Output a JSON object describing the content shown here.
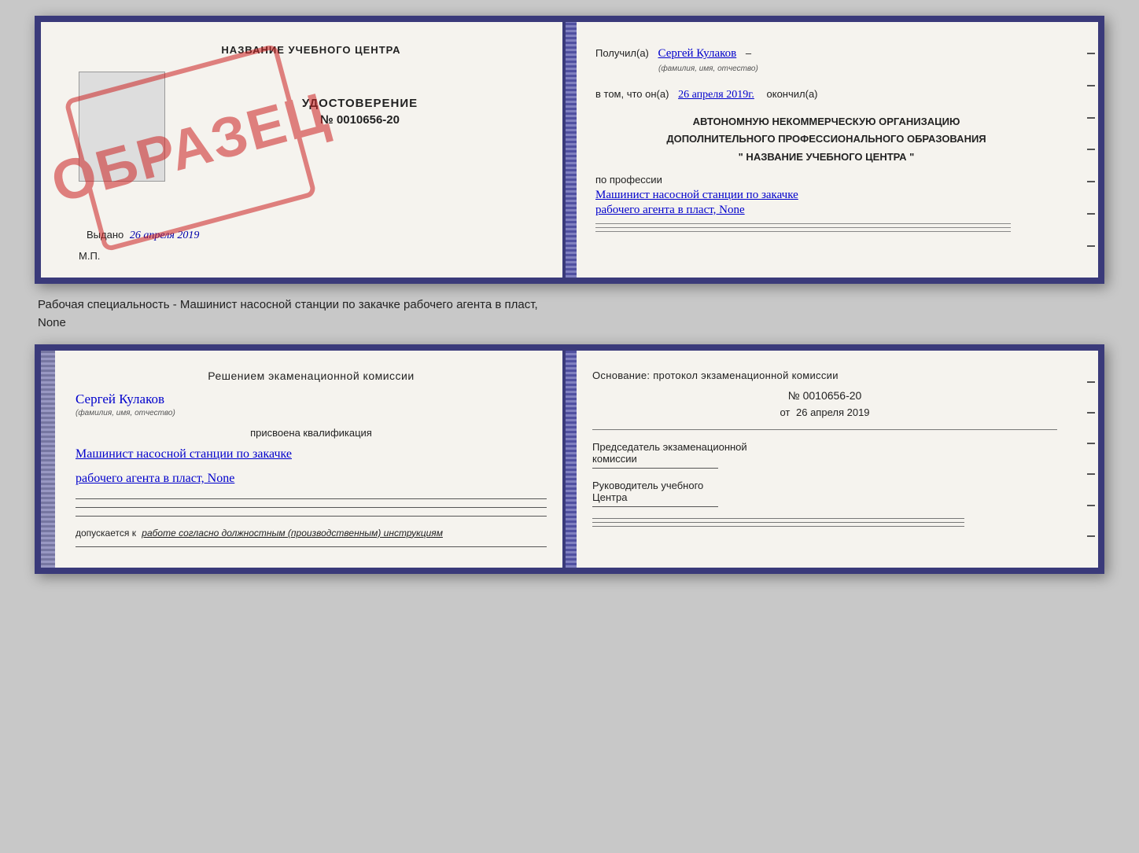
{
  "topDoc": {
    "leftPage": {
      "title": "НАЗВАНИЕ УЧЕБНОГО ЦЕНТРА",
      "certLabel": "УДОСТОВЕРЕНИЕ",
      "certNumber": "№ 0010656-20",
      "vydanoLabel": "Выдано",
      "vydanoDate": "26 апреля 2019",
      "mpLabel": "М.П.",
      "stampText": "ОБРАЗЕЦ"
    },
    "rightPage": {
      "poluchilLabel": "Получил(а)",
      "poluchilName": "Сергей Кулаков",
      "nameHint": "(фамилия, имя, отчество)",
      "dash1": "–",
      "vtomLabel": "в том, что он(а)",
      "vtomDate": "26 апреля 2019г.",
      "okonchilLabel": "окончил(а)",
      "blockLine1": "АВТОНОМНУЮ НЕКОММЕРЧЕСКУЮ ОРГАНИЗАЦИЮ",
      "blockLine2": "ДОПОЛНИТЕЛЬНОГО ПРОФЕССИОНАЛЬНОГО ОБРАЗОВАНИЯ",
      "blockLine3": "\"   НАЗВАНИЕ УЧЕБНОГО ЦЕНТРА   \"",
      "poProf": "по профессии",
      "profLine1": "Машинист насосной станции по закачке",
      "profLine2": "рабочего агента в пласт, None"
    }
  },
  "caption": {
    "line1": "Рабочая специальность - Машинист насосной станции по закачке рабочего агента в пласт,",
    "line2": "None"
  },
  "bottomDoc": {
    "leftPage": {
      "decisionText": "Решением экаменационной комиссии",
      "nameHandwritten": "Сергей Кулаков",
      "nameHint": "(фамилия, имя, отчество)",
      "prisvoenaLabel": "присвоена квалификация",
      "qualLine1": "Машинист насосной станции по закачке",
      "qualLine2": "рабочего агента в пласт, None",
      "dopuskaetsyaLabel": "допускается к",
      "dopuskaetsyaText": "работе согласно должностным (производственным) инструкциям"
    },
    "rightPage": {
      "osnovanieLabelFull": "Основание: протокол экзаменационной комиссии",
      "numberLabel": "№ 0010656-20",
      "otLabel": "от",
      "otDate": "26 апреля 2019",
      "predsedatelLine1": "Председатель экзаменационной",
      "predsedatelLine2": "комиссии",
      "rukovoditelLine1": "Руководитель учебного",
      "rukovoditelLine2": "Центра"
    }
  }
}
